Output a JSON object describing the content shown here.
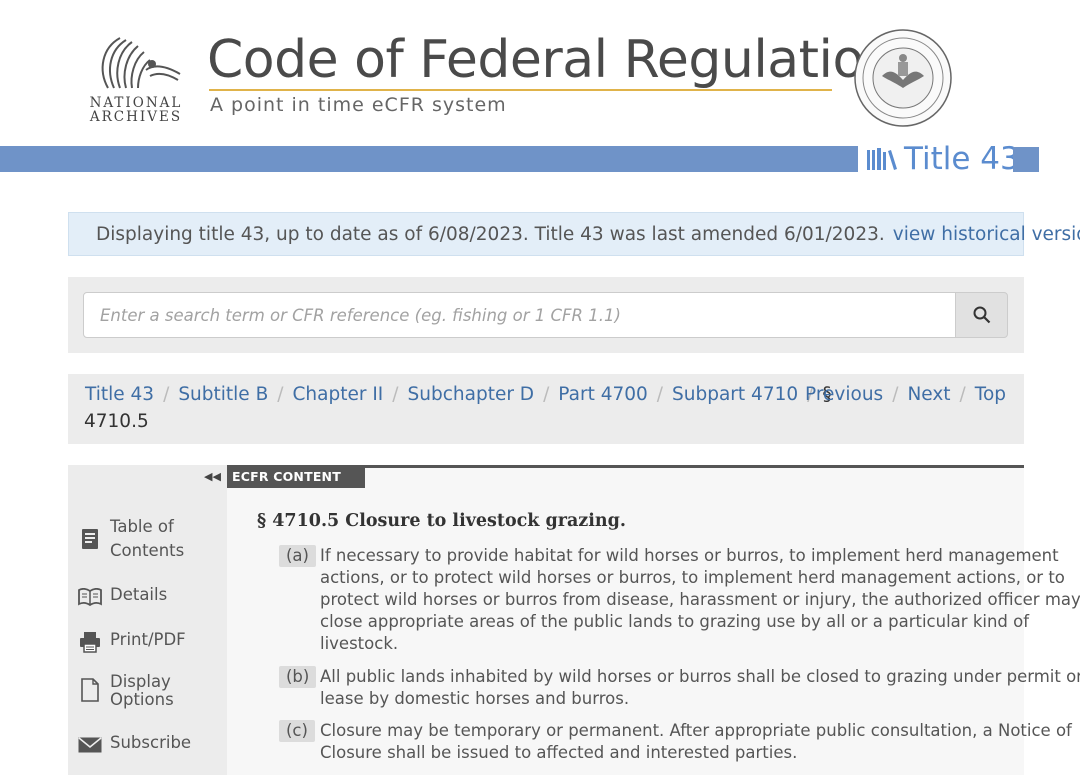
{
  "header": {
    "logo_text_line1": "NATIONAL",
    "logo_text_line2": "ARCHIVES",
    "site_title": "Code of Federal Regulations",
    "site_subtitle": "A point in time eCFR system",
    "title_badge": "Title 43"
  },
  "banner": {
    "message": "Displaying title 43, up to date as of 6/08/2023. Title 43 was last amended 6/01/2023.",
    "link": "view historical versions"
  },
  "search": {
    "placeholder": "Enter a search term or CFR reference (eg. fishing or 1 CFR 1.1)"
  },
  "breadcrumb": {
    "items": [
      "Title 43",
      "Subtitle B",
      "Chapter II",
      "Subchapter D",
      "Part 4700",
      "Subpart 4710"
    ],
    "section_symbol": "§",
    "section_number": "4710.5",
    "nav": [
      "Previous",
      "Next",
      "Top"
    ]
  },
  "sidebar": {
    "items": [
      {
        "line1": "Table of",
        "line2": "Contents"
      },
      {
        "line1": "Details",
        "line2": ""
      },
      {
        "line1": "Print/PDF",
        "line2": ""
      },
      {
        "line1": "Display",
        "line2": "Options"
      },
      {
        "line1": "Subscribe",
        "line2": ""
      }
    ]
  },
  "content": {
    "tab_label": "ECFR CONTENT",
    "heading": "§ 4710.5 Closure to livestock grazing.",
    "paragraphs": [
      {
        "label": "(a)",
        "lines": [
          "If necessary to provide habitat for wild horses or burros, to implement herd management",
          "actions, or to protect wild horses or burros, to implement herd management actions, or to",
          "protect wild horses or burros from disease, harassment or injury, the authorized officer may",
          "close appropriate areas of the public lands to grazing use by all or a particular kind of",
          "livestock."
        ]
      },
      {
        "label": "(b)",
        "lines": [
          "All public lands inhabited by wild horses or burros shall be closed to grazing under permit or",
          "lease by domestic horses and burros."
        ]
      },
      {
        "label": "(c)",
        "lines": [
          "Closure may be temporary or permanent. After appropriate public consultation, a Notice of",
          "Closure shall be issued to affected and interested parties."
        ]
      }
    ]
  }
}
